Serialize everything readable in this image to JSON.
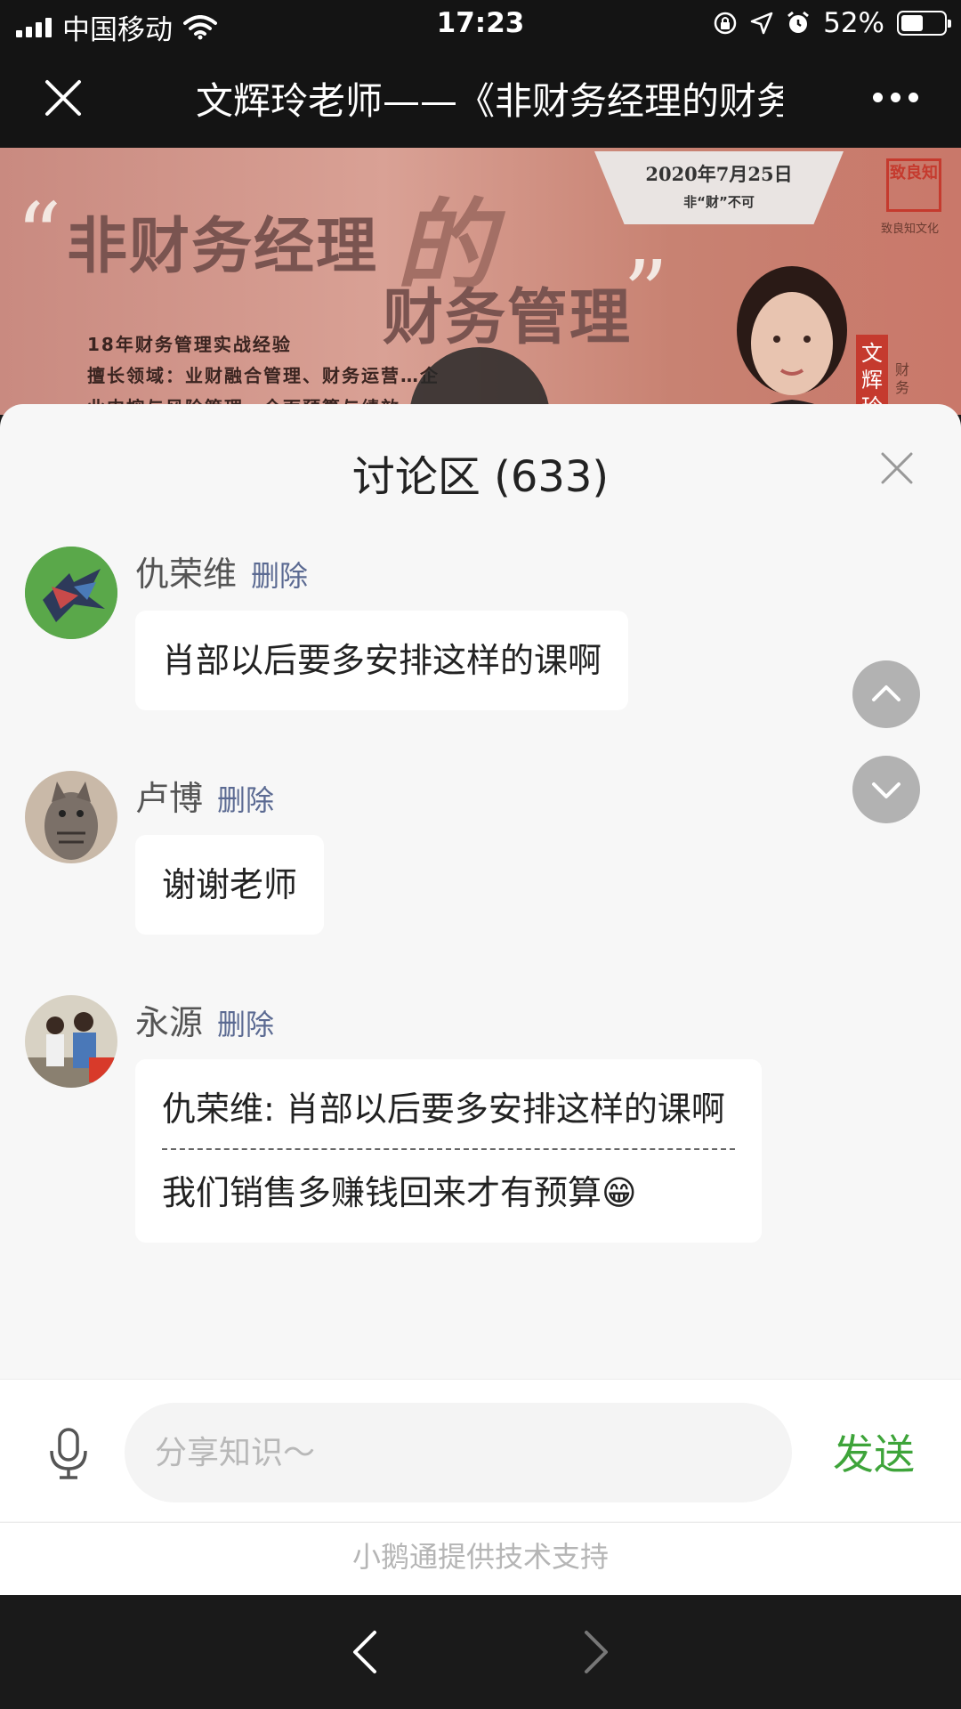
{
  "status_bar": {
    "carrier": "中国移动",
    "time": "17:23",
    "battery": "52%",
    "battery_level": 0.52
  },
  "title_bar": {
    "title": "文辉玲老师——《非财务经理的财务管理》"
  },
  "banner": {
    "quote_open": "“",
    "title_part1": "非财务经理",
    "title_de": "的",
    "title_part2": "财务管理",
    "quote_close": "”",
    "date": "2020年7月25日",
    "slogan": "非“财”不可",
    "seal": "致良知",
    "brand": "致良知文化",
    "line1": "18年财务管理实战经验",
    "line2": "擅长领域：业财融合管理、财务运营…企",
    "line3": "业内控与风险管理、全面预算与绩效…",
    "ribbon_name": "文辉玲",
    "ribbon_sub": "财务"
  },
  "discussion": {
    "title": "讨论区 (633)",
    "delete_label": "删除",
    "comments": [
      {
        "name": "仇荣维",
        "text": "肖部以后要多安排这样的课啊"
      },
      {
        "name": "卢博",
        "text": "谢谢老师"
      },
      {
        "name": "永源",
        "quote": "仇荣维: 肖部以后要多安排这样的课啊",
        "text": "我们销售多赚钱回来才有预算😁"
      }
    ]
  },
  "input": {
    "placeholder": "分享知识～",
    "send_label": "发送"
  },
  "footer": {
    "powered_by": "小鹅通提供技术支持"
  },
  "colors": {
    "accent_green": "#3ea43a",
    "link_blue": "#5b6a92",
    "sheet_bg": "#f7f7f7",
    "bar_dark": "#141414"
  },
  "icons": [
    "signal-icon",
    "wifi-icon",
    "lock-rotation-icon",
    "location-icon",
    "alarm-icon",
    "battery-icon",
    "close-icon",
    "more-icon",
    "play-icon",
    "scroll-up-icon",
    "scroll-down-icon",
    "microphone-icon",
    "back-arrow-icon",
    "forward-arrow-icon"
  ]
}
